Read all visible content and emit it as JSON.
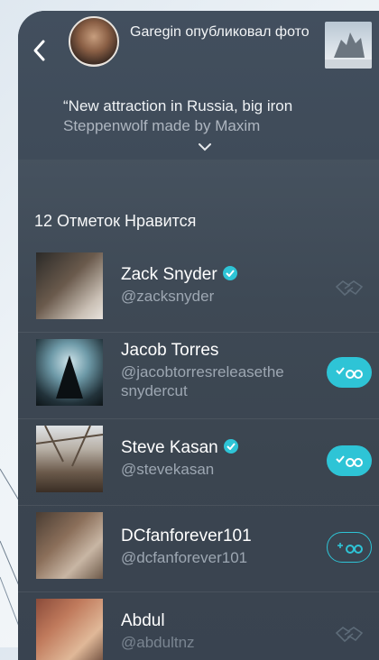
{
  "header": {
    "notification": "Garegin опубликовал фото",
    "caption_line1": "“New attraction in Russia, big iron",
    "caption_line2": "Steppenwolf made by Maxim"
  },
  "likes": {
    "title": "12 Отметок Нравится",
    "users": [
      {
        "name": "Zack Snyder",
        "handle": "@zacksnyder",
        "verified": true,
        "action": "hands-icon"
      },
      {
        "name": "Jacob Torres",
        "handle_line1": "@jacobtorresreleasethe",
        "handle_line2": "snydercut",
        "verified": false,
        "action": "following"
      },
      {
        "name": "Steve Kasan",
        "handle": "@stevekasan",
        "verified": true,
        "action": "following"
      },
      {
        "name": "DCfanforever101",
        "handle": "@dcfanforever101",
        "verified": false,
        "action": "follow"
      },
      {
        "name": "Abdul",
        "handle": "@abdultnz",
        "verified": false,
        "action": "hands-icon"
      }
    ]
  },
  "colors": {
    "accent": "#2ec4d6",
    "panel": "#3f4a57"
  }
}
